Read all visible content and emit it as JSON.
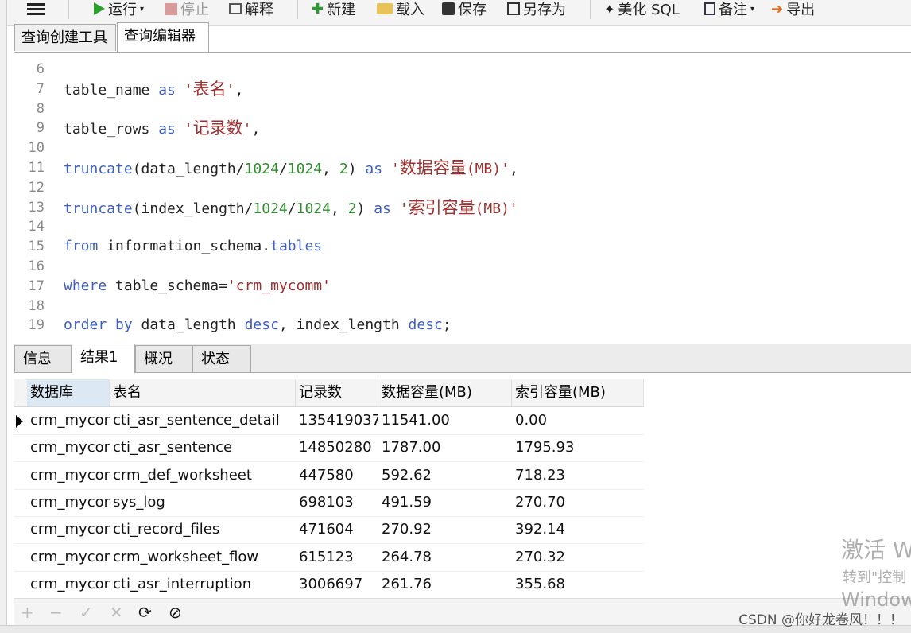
{
  "toolbar": {
    "menu_icon": "hamburger-icon",
    "run": "运行",
    "stop": "停止",
    "explain": "解释",
    "new": "新建",
    "load": "载入",
    "save": "保存",
    "save_as": "另存为",
    "beautify": "美化 SQL",
    "notes": "备注",
    "export": "导出"
  },
  "tabs": [
    "查询创建工具",
    "查询编辑器"
  ],
  "code_lines": [
    {
      "n": "6"
    },
    {
      "n": "7",
      "a": "table_name ",
      "kw": "as",
      "s": " '表名'",
      "tail": ","
    },
    {
      "n": "8"
    },
    {
      "n": "9",
      "a": "table_rows ",
      "kw": "as",
      "s": " '记录数'",
      "tail": ","
    },
    {
      "n": "10"
    },
    {
      "n": "11",
      "fn": "truncate",
      "a": "(data_length/",
      "n1": "1024",
      "sl": "/",
      "n2": "1024",
      "c": ", ",
      "n3": "2",
      "p": ") ",
      "kw": "as",
      "s": " '数据容量(MB)'",
      "tail": ","
    },
    {
      "n": "12"
    },
    {
      "n": "13",
      "fn": "truncate",
      "a": "(index_length/",
      "n1": "1024",
      "sl": "/",
      "n2": "1024",
      "c": ", ",
      "n3": "2",
      "p": ") ",
      "kw": "as",
      "s": " '索引容量(MB)'",
      "tail": ""
    },
    {
      "n": "14"
    },
    {
      "n": "15",
      "kw": "from",
      "a": " information_schema.",
      "kw2": "tables"
    },
    {
      "n": "16"
    },
    {
      "n": "17",
      "kw": "where",
      "a": " table_schema=",
      "s": "'crm_mycomm'"
    },
    {
      "n": "18"
    },
    {
      "n": "19",
      "kw": "order by",
      "a": " data_length ",
      "kw2": "desc",
      "b": ", index_length ",
      "kw3": "desc",
      "tail": ";"
    }
  ],
  "result_tabs": [
    "信息",
    "结果1",
    "概况",
    "状态"
  ],
  "columns": [
    "数据库",
    "表名",
    "记录数",
    "数据容量(MB)",
    "索引容量(MB)"
  ],
  "rows": [
    [
      "crm_mycon",
      "cti_asr_sentence_detail",
      "135419037",
      "11541.00",
      "0.00"
    ],
    [
      "crm_mycon",
      "cti_asr_sentence",
      "14850280",
      "1787.00",
      "1795.93"
    ],
    [
      "crm_mycon",
      "crm_def_worksheet",
      "447580",
      "592.62",
      "718.23"
    ],
    [
      "crm_mycon",
      "sys_log",
      "698103",
      "491.59",
      "270.70"
    ],
    [
      "crm_mycon",
      "cti_record_files",
      "471604",
      "270.92",
      "392.14"
    ],
    [
      "crm_mycon",
      "crm_worksheet_flow",
      "615123",
      "264.78",
      "270.32"
    ],
    [
      "crm_mycon",
      "cti_asr_interruption",
      "3006697",
      "261.76",
      "355.68"
    ]
  ],
  "bottom_buttons": [
    "+",
    "−",
    "✓",
    "✕",
    "⟳",
    "⊘"
  ],
  "watermark": {
    "line1": "激活 W",
    "line2": "转到\"控制",
    "line3": "Window"
  },
  "csdn": "CSDN @你好龙卷风！！！"
}
